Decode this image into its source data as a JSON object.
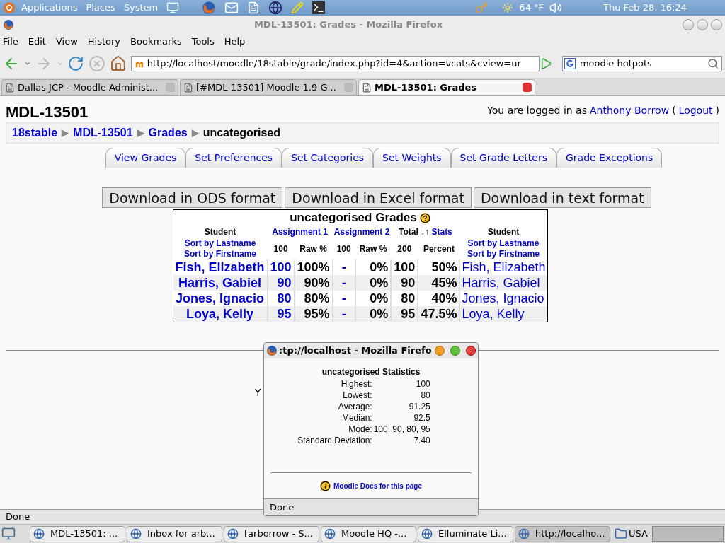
{
  "top_panel": {
    "menus": [
      "Applications",
      "Places",
      "System"
    ],
    "weather": "64 °F",
    "clock": "Thu Feb 28, 16:24"
  },
  "window": {
    "title": "MDL-13501: Grades - Mozilla Firefox"
  },
  "menu": [
    "File",
    "Edit",
    "View",
    "History",
    "Bookmarks",
    "Tools",
    "Help"
  ],
  "toolbar": {
    "url": "http://localhost/moodle/18stable/grade/index.php?id=4&action=vcats&cview=ur",
    "search": "moodle hotpots"
  },
  "browser_tabs": [
    {
      "label": "Dallas JCP - Moodle Administ...",
      "selected": false
    },
    {
      "label": "[#MDL-13501] Moodle 1.9 G...",
      "selected": false
    },
    {
      "label": "MDL-13501: Grades",
      "selected": true
    }
  ],
  "page": {
    "heading": "MDL-13501",
    "login": [
      {
        "text": "You are logged in as",
        "kind": "plain"
      },
      {
        "text": "Anthony Borrow",
        "kind": "link"
      },
      {
        "text": "(",
        "kind": "plain"
      },
      {
        "text": "Logout",
        "kind": "link"
      },
      {
        "text": ")",
        "kind": "plain"
      }
    ],
    "breadcrumb": {
      "separator": "▶",
      "items": [
        {
          "label": "18stable",
          "link": true
        },
        {
          "label": "MDL-13501",
          "link": true
        },
        {
          "label": "Grades",
          "link": true
        },
        {
          "label": "uncategorised",
          "link": false
        }
      ]
    },
    "tabs": [
      {
        "label": "View Grades",
        "selected": false
      },
      {
        "label": "Set Preferences",
        "selected": false
      },
      {
        "label": "Set Categories",
        "selected": false
      },
      {
        "label": "Set Weights",
        "selected": false
      },
      {
        "label": "Set Grade Letters",
        "selected": false
      },
      {
        "label": "Grade Exceptions",
        "selected": false
      }
    ],
    "downloads": [
      "Download in ODS format",
      "Download in Excel format",
      "Download in text format"
    ],
    "grades": {
      "title": "uncategorised Grades",
      "student": "Student",
      "student_right": "Student",
      "sort_lastname_right": "Sort by Lastname",
      "sort_firstname_right": "Sort by Firstname",
      "assignments": [
        "Assignment 1",
        "Assignment 2"
      ],
      "total": "Total",
      "sort_arrows": "↓↑",
      "stats": "Stats",
      "sort_lastname": "Sort by Lastname",
      "sort_firstname": "Sort by Firstname",
      "subheaders": [
        "100",
        "Raw %",
        "100",
        "Raw %",
        "200",
        "Percent"
      ],
      "rows": [
        {
          "name": "Fish, Elizabeth",
          "a1": "100",
          "a1_raw": "100%",
          "a2": "-",
          "a2_raw": "0%",
          "total": "100",
          "percent": "50%",
          "name_right": "Fish, Elizabeth"
        },
        {
          "name": "Harris, Gabiel",
          "a1": "90",
          "a1_raw": "90%",
          "a2": "-",
          "a2_raw": "0%",
          "total": "90",
          "percent": "45%",
          "name_right": "Harris, Gabiel"
        },
        {
          "name": "Jones, Ignacio",
          "a1": "80",
          "a1_raw": "80%",
          "a2": "-",
          "a2_raw": "0%",
          "total": "80",
          "percent": "40%",
          "name_right": "Jones, Ignacio"
        },
        {
          "name": "Loya, Kelly",
          "a1": "95",
          "a1_raw": "95%",
          "a2": "-",
          "a2_raw": "0%",
          "total": "95",
          "percent": "47.5%",
          "name_right": "Loya, Kelly"
        }
      ]
    },
    "hidden_text": "Y"
  },
  "popup": {
    "title": ":tp://localhost - Mozilla Firefo",
    "heading": "uncategorised Statistics",
    "stats": [
      {
        "label": "Highest:",
        "value": "100"
      },
      {
        "label": "Lowest:",
        "value": "80"
      },
      {
        "label": "Average:",
        "value": "91.25"
      },
      {
        "label": "Median:",
        "value": "92.5"
      },
      {
        "label": "Mode:",
        "value": "100, 90, 80, 95"
      },
      {
        "label": "Standard Deviation:",
        "value": "7.40"
      }
    ],
    "docs_link": "Moodle Docs for this page",
    "status": "Done"
  },
  "status_bar": "Done",
  "taskbar": {
    "items": [
      {
        "label": "MDL-13501: ...",
        "selected": false
      },
      {
        "label": "Inbox for arb...",
        "selected": false
      },
      {
        "label": "[arborrow - S...",
        "selected": false
      },
      {
        "label": "Moodle HQ -...",
        "selected": false
      },
      {
        "label": "Elluminate Li...",
        "selected": false
      },
      {
        "label": "http://localho...",
        "selected": true
      }
    ],
    "keyboard": "USA"
  }
}
